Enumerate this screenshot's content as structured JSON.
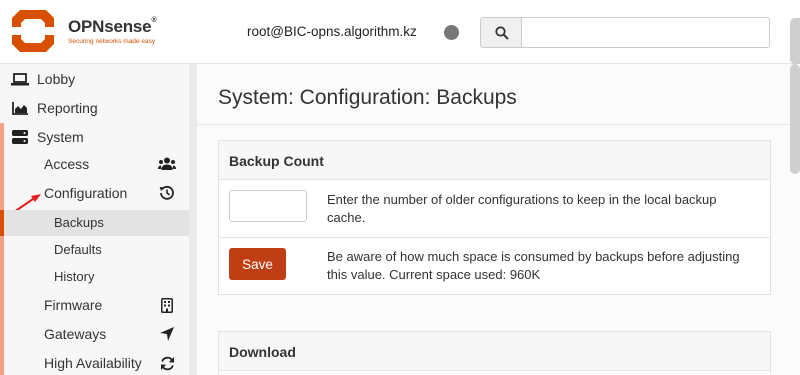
{
  "header": {
    "brand_name": "OPNsense",
    "brand_reg": "®",
    "brand_tagline": "Securing networks made easy",
    "user": "root@BIC-opns.algorithm.kz",
    "search_placeholder": ""
  },
  "sidebar": {
    "items": [
      {
        "label": "Lobby",
        "icon": "laptop-icon"
      },
      {
        "label": "Reporting",
        "icon": "area-chart-icon"
      },
      {
        "label": "System",
        "icon": "server-icon"
      }
    ],
    "system_sub": [
      {
        "label": "Access",
        "icon": "users-icon"
      },
      {
        "label": "Configuration",
        "icon": "history-icon"
      }
    ],
    "configuration_sub": [
      {
        "label": "Backups",
        "active": true
      },
      {
        "label": "Defaults"
      },
      {
        "label": "History"
      }
    ],
    "more_sub": [
      {
        "label": "Firmware",
        "icon": "building-icon"
      },
      {
        "label": "Gateways",
        "icon": "location-arrow-icon"
      },
      {
        "label": "High Availability",
        "icon": "refresh-icon"
      }
    ]
  },
  "main": {
    "page_title": "System: Configuration: Backups",
    "backup_count": {
      "title": "Backup Count",
      "input_value": "",
      "input_help": "Enter the number of older configurations to keep in the local backup cache.",
      "save_label": "Save",
      "save_help": "Be aware of how much space is consumed by backups before adjusting this value. Current space used: 960K"
    },
    "download": {
      "title": "Download"
    }
  },
  "colors": {
    "accent": "#d94f00",
    "save_button": "#c03e14",
    "sidebar_bar": "#f2a285"
  }
}
